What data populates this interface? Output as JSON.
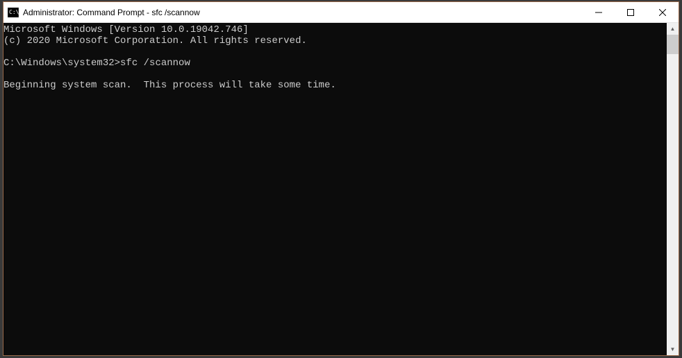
{
  "titlebar": {
    "title": "Administrator: Command Prompt - sfc  /scannow",
    "icon_name": "cmd-icon"
  },
  "window_controls": {
    "minimize": "minimize",
    "maximize": "maximize",
    "close": "close"
  },
  "terminal": {
    "line1": "Microsoft Windows [Version 10.0.19042.746]",
    "line2": "(c) 2020 Microsoft Corporation. All rights reserved.",
    "blank1": "",
    "prompt_line_prefix": "C:\\Windows\\system32>",
    "prompt_line_cmd": "sfc /scannow",
    "blank2": "",
    "line3": "Beginning system scan.  This process will take some time."
  }
}
